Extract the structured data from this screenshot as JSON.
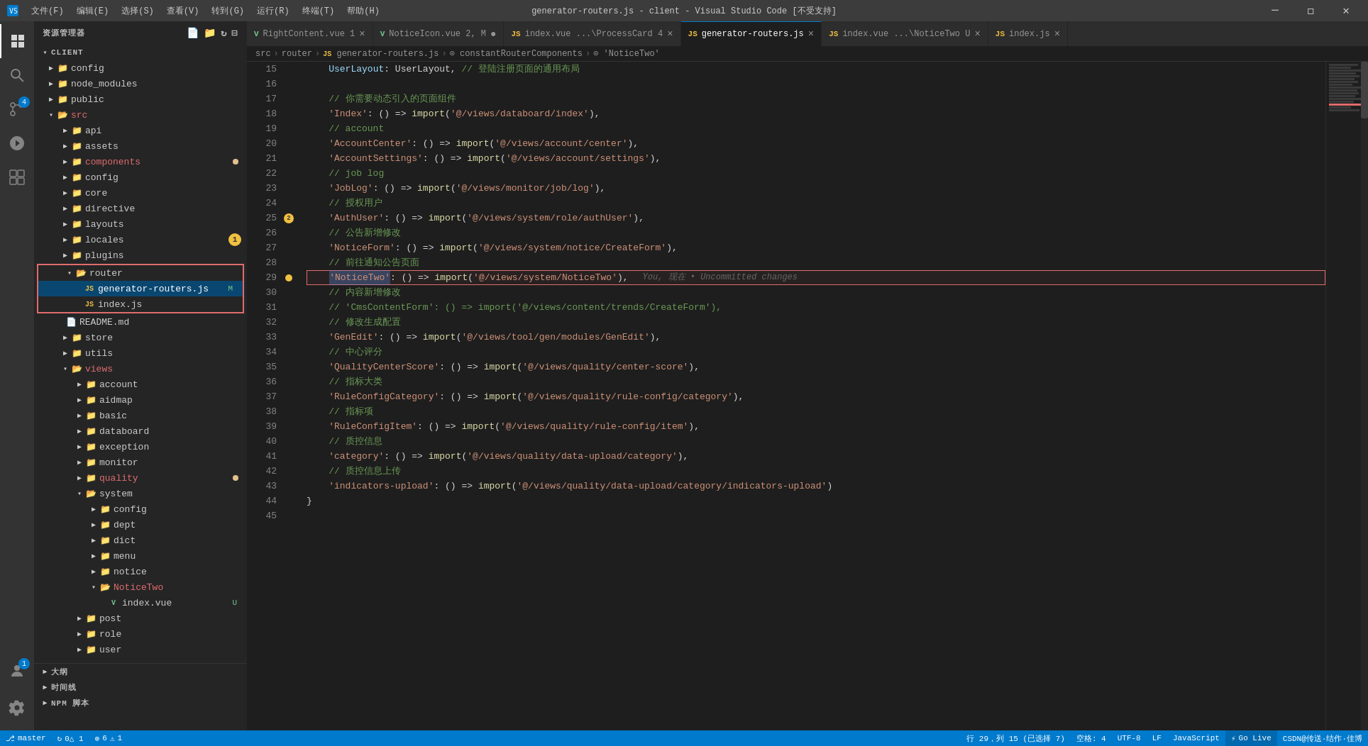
{
  "titleBar": {
    "title": "generator-routers.js - client - Visual Studio Code [不受支持]",
    "menus": [
      "文件(F)",
      "编辑(E)",
      "选择(S)",
      "查看(V)",
      "转到(G)",
      "运行(R)",
      "终端(T)",
      "帮助(H)"
    ]
  },
  "tabs": [
    {
      "id": "tab1",
      "icon": "vue",
      "label": "RightContent.vue",
      "index": "1",
      "modified": false,
      "active": false
    },
    {
      "id": "tab2",
      "icon": "vue",
      "label": "NoticeIcon.vue",
      "index": "2",
      "modified": true,
      "active": false
    },
    {
      "id": "tab3",
      "icon": "js",
      "label": "index.vue ...\\ProcessCard",
      "index": "4",
      "modified": false,
      "active": false
    },
    {
      "id": "tab4",
      "icon": "js",
      "label": "generator-routers.js",
      "index": "",
      "modified": false,
      "active": true
    },
    {
      "id": "tab5",
      "icon": "js",
      "label": "index.vue ...\\NoticeTwo",
      "index": "U",
      "modified": false,
      "active": false
    },
    {
      "id": "tab6",
      "icon": "js",
      "label": "index.js",
      "index": "",
      "modified": false,
      "active": false
    }
  ],
  "breadcrumb": {
    "parts": [
      "src",
      "router",
      "JS generator-routers.js",
      "⊙ constantRouterComponents",
      "⊙ 'NoticeTwo'"
    ]
  },
  "sidebar": {
    "title": "资源管理器",
    "clientLabel": "CLIENT",
    "tree": [
      {
        "level": 0,
        "type": "dir",
        "label": "config",
        "open": false,
        "color": "#cccccc"
      },
      {
        "level": 0,
        "type": "dir",
        "label": "node_modules",
        "open": false,
        "color": "#cccccc"
      },
      {
        "level": 0,
        "type": "dir",
        "label": "public",
        "open": false,
        "color": "#cccccc"
      },
      {
        "level": 0,
        "type": "dir",
        "label": "src",
        "open": true,
        "color": "#e06c6c"
      },
      {
        "level": 1,
        "type": "dir",
        "label": "api",
        "open": false,
        "color": "#cccccc"
      },
      {
        "level": 1,
        "type": "dir",
        "label": "assets",
        "open": false,
        "color": "#cccccc"
      },
      {
        "level": 1,
        "type": "dir",
        "label": "components",
        "open": false,
        "color": "#e06c6c",
        "dot": "yellow"
      },
      {
        "level": 1,
        "type": "dir",
        "label": "config",
        "open": false,
        "color": "#cccccc"
      },
      {
        "level": 1,
        "type": "dir",
        "label": "core",
        "open": false,
        "color": "#cccccc"
      },
      {
        "level": 1,
        "type": "dir",
        "label": "directive",
        "open": false,
        "color": "#cccccc"
      },
      {
        "level": 1,
        "type": "dir",
        "label": "layouts",
        "open": false,
        "color": "#cccccc"
      },
      {
        "level": 1,
        "type": "dir",
        "label": "locales",
        "open": false,
        "color": "#cccccc",
        "badge": "1"
      },
      {
        "level": 1,
        "type": "dir",
        "label": "plugins",
        "open": false,
        "color": "#cccccc"
      },
      {
        "level": 1,
        "type": "dir",
        "label": "router",
        "open": true,
        "color": "#cccccc",
        "boxed": true
      },
      {
        "level": 2,
        "type": "file",
        "label": "generator-routers.js",
        "open": false,
        "color": "#cccccc",
        "selected": true,
        "modLabel": "M"
      },
      {
        "level": 2,
        "type": "file",
        "label": "index.js",
        "open": false,
        "color": "#cccccc"
      },
      {
        "level": 1,
        "type": "file",
        "label": "README.md",
        "open": false,
        "color": "#cccccc"
      },
      {
        "level": 1,
        "type": "dir",
        "label": "store",
        "open": false,
        "color": "#cccccc"
      },
      {
        "level": 1,
        "type": "dir",
        "label": "utils",
        "open": false,
        "color": "#cccccc"
      },
      {
        "level": 1,
        "type": "dir",
        "label": "views",
        "open": true,
        "color": "#e06c6c"
      },
      {
        "level": 2,
        "type": "dir",
        "label": "account",
        "open": false,
        "color": "#cccccc"
      },
      {
        "level": 2,
        "type": "dir",
        "label": "aidmap",
        "open": false,
        "color": "#cccccc"
      },
      {
        "level": 2,
        "type": "dir",
        "label": "basic",
        "open": false,
        "color": "#cccccc"
      },
      {
        "level": 2,
        "type": "dir",
        "label": "databoard",
        "open": false,
        "color": "#cccccc"
      },
      {
        "level": 2,
        "type": "dir",
        "label": "exception",
        "open": false,
        "color": "#cccccc"
      },
      {
        "level": 2,
        "type": "dir",
        "label": "monitor",
        "open": false,
        "color": "#cccccc"
      },
      {
        "level": 2,
        "type": "dir",
        "label": "quality",
        "open": false,
        "color": "#e06c6c",
        "dot": "yellow"
      },
      {
        "level": 2,
        "type": "dir",
        "label": "system",
        "open": true,
        "color": "#cccccc"
      },
      {
        "level": 3,
        "type": "dir",
        "label": "config",
        "open": false,
        "color": "#cccccc"
      },
      {
        "level": 3,
        "type": "dir",
        "label": "dept",
        "open": false,
        "color": "#cccccc"
      },
      {
        "level": 3,
        "type": "dir",
        "label": "dict",
        "open": false,
        "color": "#cccccc"
      },
      {
        "level": 3,
        "type": "dir",
        "label": "menu",
        "open": false,
        "color": "#cccccc"
      },
      {
        "level": 3,
        "type": "dir",
        "label": "notice",
        "open": false,
        "color": "#cccccc"
      },
      {
        "level": 3,
        "type": "dir",
        "label": "NoticeTwo",
        "open": true,
        "color": "#e06c6c"
      },
      {
        "level": 4,
        "type": "file",
        "label": "index.vue",
        "open": false,
        "color": "#73c991",
        "modLabel": "U"
      },
      {
        "level": 2,
        "type": "dir",
        "label": "post",
        "open": false,
        "color": "#cccccc"
      },
      {
        "level": 2,
        "type": "dir",
        "label": "role",
        "open": false,
        "color": "#cccccc"
      },
      {
        "level": 2,
        "type": "dir",
        "label": "user",
        "open": false,
        "color": "#cccccc"
      }
    ]
  },
  "statusBar": {
    "branch": "master",
    "sync": "⟳ 0△ 1",
    "errors": "⊗ 6△ 1",
    "position": "行 29，列 15 (已选择 7)",
    "spaces": "空格: 4",
    "encoding": "UTF-8",
    "lineEnding": "LF",
    "language": "JavaScript",
    "liveshare": "Go Live",
    "csdn": "CSDN@传送·结作·佳博"
  },
  "code": {
    "lines": [
      {
        "num": 15,
        "content": "    UserLayout: UserLayout, // 登陆注册页面的通用布局",
        "type": "normal"
      },
      {
        "num": 16,
        "content": "",
        "type": "normal"
      },
      {
        "num": 17,
        "content": "    // 你需要动态引入的页面组件",
        "type": "comment"
      },
      {
        "num": 18,
        "content": "    'Index': () => import('@/views/databoard/index'),",
        "type": "normal"
      },
      {
        "num": 19,
        "content": "    // account",
        "type": "comment"
      },
      {
        "num": 20,
        "content": "    'AccountCenter': () => import('@/views/account/center'),",
        "type": "normal"
      },
      {
        "num": 21,
        "content": "    'AccountSettings': () => import('@/views/account/settings'),",
        "type": "normal"
      },
      {
        "num": 22,
        "content": "    // job log",
        "type": "comment"
      },
      {
        "num": 23,
        "content": "    'JobLog': () => import('@/views/monitor/job/log'),",
        "type": "normal"
      },
      {
        "num": 24,
        "content": "    // 授权用户",
        "type": "comment"
      },
      {
        "num": 25,
        "content": "    'AuthUser': () => import('@/views/system/role/authUser'),",
        "type": "normal"
      },
      {
        "num": 26,
        "content": "    // 公告新增修改",
        "type": "comment"
      },
      {
        "num": 27,
        "content": "    'NoticeForm': () => import('@/views/system/notice/CreateForm'),",
        "type": "normal"
      },
      {
        "num": 28,
        "content": "    // 前往通知公告页面",
        "type": "comment"
      },
      {
        "num": 29,
        "content": "    'NoticeTwo': () => import('@/views/system/NoticeTwo'),",
        "type": "highlight",
        "gutter": "circle"
      },
      {
        "num": 30,
        "content": "    // 内容新增修改",
        "type": "comment"
      },
      {
        "num": 31,
        "content": "    // 'CmsContentForm': () => import('@/views/content/trends/CreateForm'),",
        "type": "comment"
      },
      {
        "num": 32,
        "content": "    // 修改生成配置",
        "type": "comment"
      },
      {
        "num": 33,
        "content": "    'GenEdit': () => import('@/views/tool/gen/modules/GenEdit'),",
        "type": "normal"
      },
      {
        "num": 34,
        "content": "    // 中心评分",
        "type": "comment"
      },
      {
        "num": 35,
        "content": "    'QualityCenterScore': () => import('@/views/quality/center-score'),",
        "type": "normal"
      },
      {
        "num": 36,
        "content": "    // 指标大类",
        "type": "comment"
      },
      {
        "num": 37,
        "content": "    'RuleConfigCategory': () => import('@/views/quality/rule-config/category'),",
        "type": "normal"
      },
      {
        "num": 38,
        "content": "    // 指标项",
        "type": "comment"
      },
      {
        "num": 39,
        "content": "    'RuleConfigItem': () => import('@/views/quality/rule-config/item'),",
        "type": "normal"
      },
      {
        "num": 40,
        "content": "    // 质控信息",
        "type": "comment"
      },
      {
        "num": 41,
        "content": "    'category': () => import('@/views/quality/data-upload/category'),",
        "type": "normal"
      },
      {
        "num": 42,
        "content": "    // 质控信息上传",
        "type": "comment"
      },
      {
        "num": 43,
        "content": "    'indicators-upload': () => import('@/views/quality/data-upload/category/indicators-upload')",
        "type": "normal"
      },
      {
        "num": 44,
        "content": "}",
        "type": "normal"
      },
      {
        "num": 45,
        "content": "",
        "type": "normal"
      }
    ]
  }
}
